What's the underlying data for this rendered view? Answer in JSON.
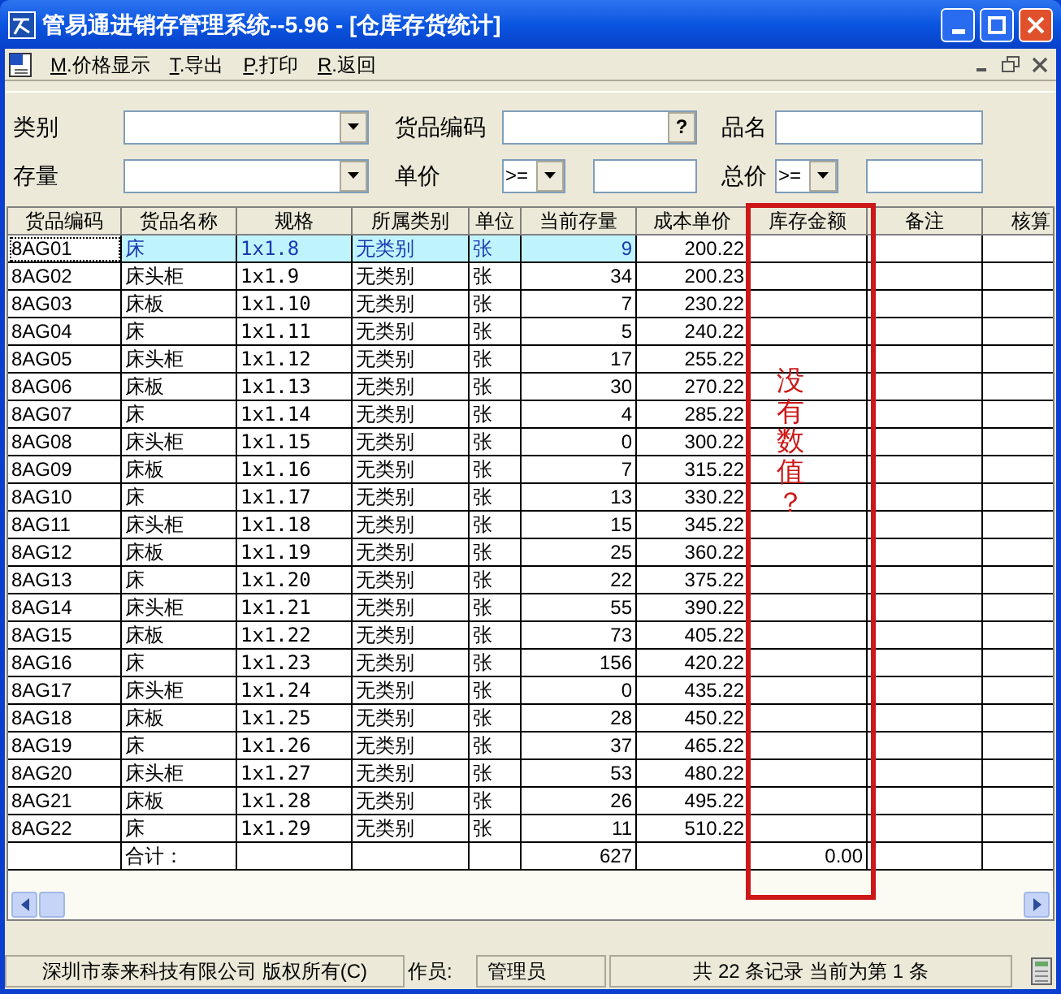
{
  "window": {
    "title": "管易通进销存管理系统--5.96 - [仓库存货统计]"
  },
  "menu": [
    {
      "key": "M",
      "label": ".价格显示"
    },
    {
      "key": "T",
      "label": ".导出"
    },
    {
      "key": "P",
      "label": ".打印"
    },
    {
      "key": "R",
      "label": ".返回"
    }
  ],
  "filters": {
    "category": {
      "label": "类别"
    },
    "code": {
      "label": "货品编码",
      "button": "?"
    },
    "name": {
      "label": "品名"
    },
    "stock": {
      "label": "存量"
    },
    "unit_price": {
      "label": "单价",
      "operator": ">="
    },
    "total_price": {
      "label": "总价",
      "operator": ">="
    }
  },
  "table": {
    "columns": [
      "货品编码",
      "货品名称",
      "规格",
      "所属类别",
      "单位",
      "当前存量",
      "成本单价",
      "库存金额",
      "备注",
      "核算"
    ],
    "rows": [
      {
        "code": "8AG01",
        "name": "床",
        "spec": "1x1.8",
        "category": "无类别",
        "unit": "张",
        "stock": "9",
        "unit_cost": "200.22",
        "selected": true
      },
      {
        "code": "8AG02",
        "name": "床头柜",
        "spec": "1x1.9",
        "category": "无类别",
        "unit": "张",
        "stock": "34",
        "unit_cost": "200.23",
        "selected": false
      },
      {
        "code": "8AG03",
        "name": "床板",
        "spec": "1x1.10",
        "category": "无类别",
        "unit": "张",
        "stock": "7",
        "unit_cost": "230.22",
        "selected": false
      },
      {
        "code": "8AG04",
        "name": "床",
        "spec": "1x1.11",
        "category": "无类别",
        "unit": "张",
        "stock": "5",
        "unit_cost": "240.22",
        "selected": false
      },
      {
        "code": "8AG05",
        "name": "床头柜",
        "spec": "1x1.12",
        "category": "无类别",
        "unit": "张",
        "stock": "17",
        "unit_cost": "255.22",
        "selected": false
      },
      {
        "code": "8AG06",
        "name": "床板",
        "spec": "1x1.13",
        "category": "无类别",
        "unit": "张",
        "stock": "30",
        "unit_cost": "270.22",
        "selected": false
      },
      {
        "code": "8AG07",
        "name": "床",
        "spec": "1x1.14",
        "category": "无类别",
        "unit": "张",
        "stock": "4",
        "unit_cost": "285.22",
        "selected": false
      },
      {
        "code": "8AG08",
        "name": "床头柜",
        "spec": "1x1.15",
        "category": "无类别",
        "unit": "张",
        "stock": "0",
        "unit_cost": "300.22",
        "selected": false
      },
      {
        "code": "8AG09",
        "name": "床板",
        "spec": "1x1.16",
        "category": "无类别",
        "unit": "张",
        "stock": "7",
        "unit_cost": "315.22",
        "selected": false
      },
      {
        "code": "8AG10",
        "name": "床",
        "spec": "1x1.17",
        "category": "无类别",
        "unit": "张",
        "stock": "13",
        "unit_cost": "330.22",
        "selected": false
      },
      {
        "code": "8AG11",
        "name": "床头柜",
        "spec": "1x1.18",
        "category": "无类别",
        "unit": "张",
        "stock": "15",
        "unit_cost": "345.22",
        "selected": false
      },
      {
        "code": "8AG12",
        "name": "床板",
        "spec": "1x1.19",
        "category": "无类别",
        "unit": "张",
        "stock": "25",
        "unit_cost": "360.22",
        "selected": false
      },
      {
        "code": "8AG13",
        "name": "床",
        "spec": "1x1.20",
        "category": "无类别",
        "unit": "张",
        "stock": "22",
        "unit_cost": "375.22",
        "selected": false
      },
      {
        "code": "8AG14",
        "name": "床头柜",
        "spec": "1x1.21",
        "category": "无类别",
        "unit": "张",
        "stock": "55",
        "unit_cost": "390.22",
        "selected": false
      },
      {
        "code": "8AG15",
        "name": "床板",
        "spec": "1x1.22",
        "category": "无类别",
        "unit": "张",
        "stock": "73",
        "unit_cost": "405.22",
        "selected": false
      },
      {
        "code": "8AG16",
        "name": "床",
        "spec": "1x1.23",
        "category": "无类别",
        "unit": "张",
        "stock": "156",
        "unit_cost": "420.22",
        "selected": false
      },
      {
        "code": "8AG17",
        "name": "床头柜",
        "spec": "1x1.24",
        "category": "无类别",
        "unit": "张",
        "stock": "0",
        "unit_cost": "435.22",
        "selected": false
      },
      {
        "code": "8AG18",
        "name": "床板",
        "spec": "1x1.25",
        "category": "无类别",
        "unit": "张",
        "stock": "28",
        "unit_cost": "450.22",
        "selected": false
      },
      {
        "code": "8AG19",
        "name": "床",
        "spec": "1x1.26",
        "category": "无类别",
        "unit": "张",
        "stock": "37",
        "unit_cost": "465.22",
        "selected": false
      },
      {
        "code": "8AG20",
        "name": "床头柜",
        "spec": "1x1.27",
        "category": "无类别",
        "unit": "张",
        "stock": "53",
        "unit_cost": "480.22",
        "selected": false
      },
      {
        "code": "8AG21",
        "name": "床板",
        "spec": "1x1.28",
        "category": "无类别",
        "unit": "张",
        "stock": "26",
        "unit_cost": "495.22",
        "selected": false
      },
      {
        "code": "8AG22",
        "name": "床",
        "spec": "1x1.29",
        "category": "无类别",
        "unit": "张",
        "stock": "11",
        "unit_cost": "510.22",
        "selected": false
      }
    ],
    "total": {
      "label": "合计：",
      "stock": "627",
      "amount": "0.00"
    }
  },
  "annotation": {
    "text": "没有数值？"
  },
  "status_bar": {
    "copyright": "深圳市泰来科技有限公司 版权所有(C)",
    "operator_label": "作员:",
    "operator": "管理员",
    "records": "共 22 条记录 当前为第 1 条"
  }
}
